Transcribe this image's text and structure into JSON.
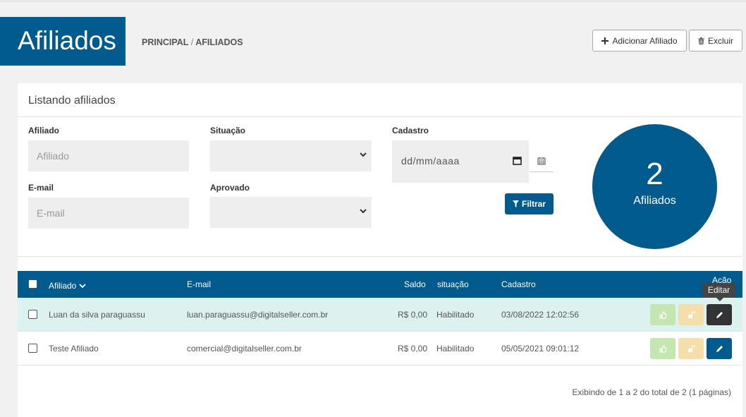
{
  "header": {
    "title": "Afiliados",
    "breadcrumb": {
      "root": "PRINCIPAL",
      "separator": "/",
      "current": "AFILIADOS"
    },
    "add_button": "Adicionar Afiliado",
    "delete_button": "Excluir"
  },
  "card": {
    "title": "Listando afiliados",
    "filters": {
      "affiliate_label": "Afiliado",
      "affiliate_placeholder": "Afiliado",
      "status_label": "Situação",
      "status_value": "",
      "registration_label": "Cadastro",
      "registration_placeholder": "dd/mm/aaaa",
      "email_label": "E-mail",
      "email_placeholder": "E-mail",
      "approved_label": "Aprovado",
      "approved_value": "",
      "filter_button": "Filtrar"
    },
    "summary": {
      "count": "2",
      "label": "Afiliados"
    }
  },
  "table": {
    "columns": {
      "affiliate": "Afiliado",
      "email": "E-mail",
      "balance": "Saldo",
      "status": "situação",
      "registration": "Cadastro",
      "action": "Ação"
    },
    "rows": [
      {
        "name": "Luan da silva paraguassu",
        "email": "luan.paraguassu@digitalseller.com.br",
        "balance": "R$ 0,00",
        "status": "Habilitado",
        "registration": "03/08/2022 12:02:56"
      },
      {
        "name": "Teste Afiliado",
        "email": "comercial@digitalseller.com.br",
        "balance": "R$ 0,00",
        "status": "Habilitado",
        "registration": "05/05/2021 09:01:12"
      }
    ],
    "tooltip": "Editar",
    "pagination": "Exibindo de 1 a 2 do total de 2 (1 páginas)"
  },
  "colors": {
    "primary": "#005a8c",
    "row_highlight": "#dcf2ee",
    "approve": "#c5e6b0",
    "unlock": "#f5deaa",
    "edit_active": "#333333"
  },
  "icons": [
    "plus-icon",
    "trash-icon",
    "chevron-down-icon",
    "calendar-icon",
    "filter-icon",
    "thumbs-up-icon",
    "unlock-icon",
    "pencil-icon"
  ]
}
